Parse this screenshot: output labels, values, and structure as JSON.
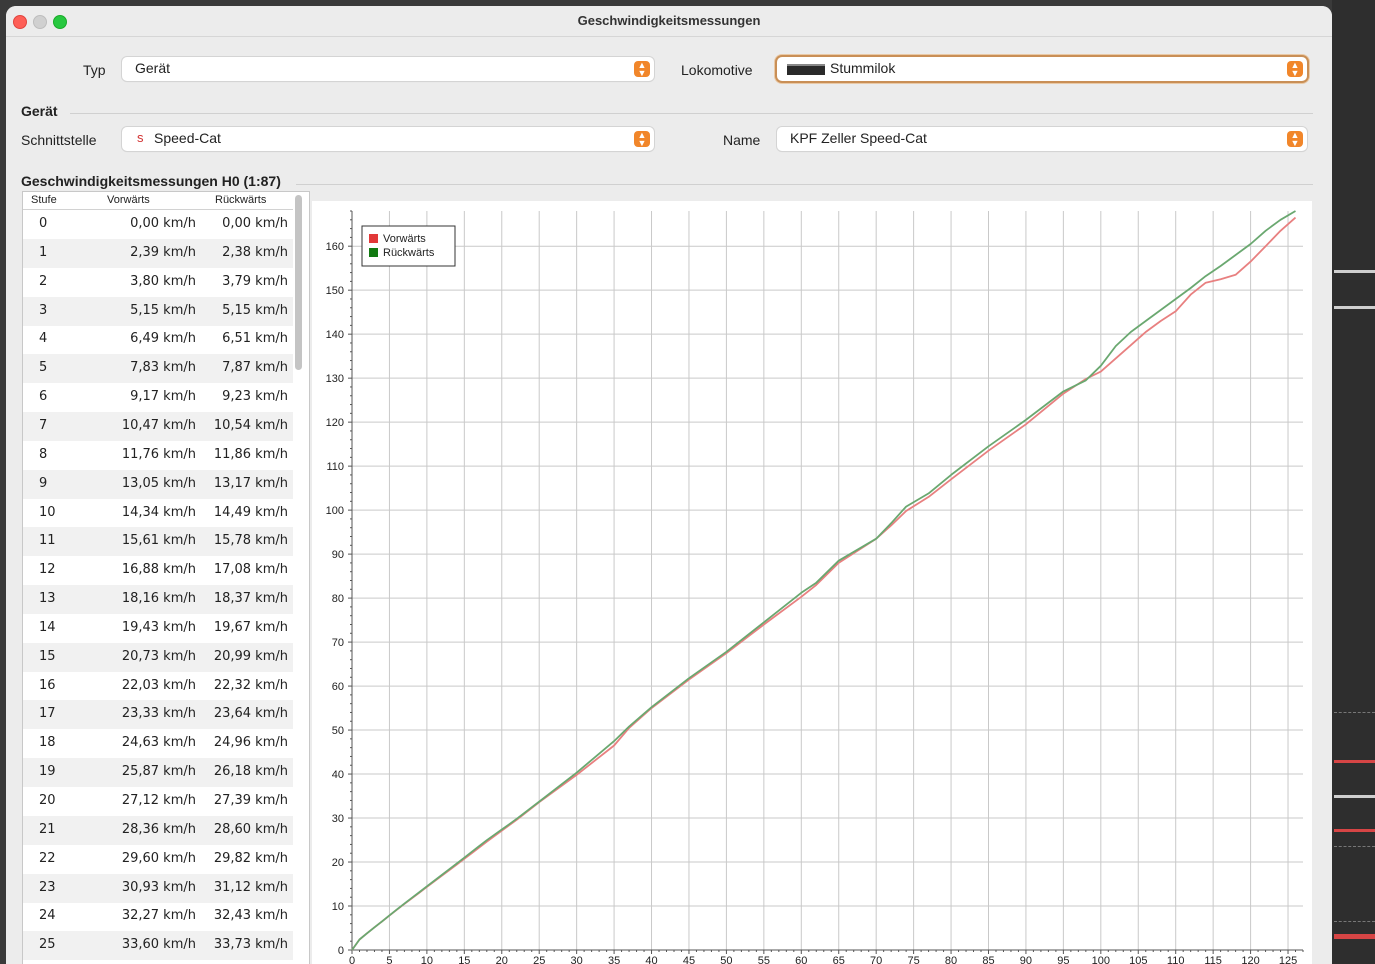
{
  "window": {
    "title": "Geschwindigkeitsmessungen"
  },
  "form": {
    "typ_label": "Typ",
    "typ_value": "Gerät",
    "lok_label": "Lokomotive",
    "lok_value": "Stummilok",
    "geraet_section": "Gerät",
    "schnittstelle_label": "Schnittstelle",
    "schnittstelle_icon": "s",
    "schnittstelle_value": "Speed-Cat",
    "name_label": "Name",
    "name_value": "KPF Zeller Speed-Cat"
  },
  "measurements": {
    "title": "Geschwindigkeitsmessungen H0 (1:87)",
    "columns": [
      "Stufe",
      "Vorwärts",
      "Rückwärts"
    ],
    "rows": [
      [
        "0",
        "0,00 km/h",
        "0,00 km/h"
      ],
      [
        "1",
        "2,39 km/h",
        "2,38 km/h"
      ],
      [
        "2",
        "3,80 km/h",
        "3,79 km/h"
      ],
      [
        "3",
        "5,15 km/h",
        "5,15 km/h"
      ],
      [
        "4",
        "6,49 km/h",
        "6,51 km/h"
      ],
      [
        "5",
        "7,83 km/h",
        "7,87 km/h"
      ],
      [
        "6",
        "9,17 km/h",
        "9,23 km/h"
      ],
      [
        "7",
        "10,47 km/h",
        "10,54 km/h"
      ],
      [
        "8",
        "11,76 km/h",
        "11,86 km/h"
      ],
      [
        "9",
        "13,05 km/h",
        "13,17 km/h"
      ],
      [
        "10",
        "14,34 km/h",
        "14,49 km/h"
      ],
      [
        "11",
        "15,61 km/h",
        "15,78 km/h"
      ],
      [
        "12",
        "16,88 km/h",
        "17,08 km/h"
      ],
      [
        "13",
        "18,16 km/h",
        "18,37 km/h"
      ],
      [
        "14",
        "19,43 km/h",
        "19,67 km/h"
      ],
      [
        "15",
        "20,73 km/h",
        "20,99 km/h"
      ],
      [
        "16",
        "22,03 km/h",
        "22,32 km/h"
      ],
      [
        "17",
        "23,33 km/h",
        "23,64 km/h"
      ],
      [
        "18",
        "24,63 km/h",
        "24,96 km/h"
      ],
      [
        "19",
        "25,87 km/h",
        "26,18 km/h"
      ],
      [
        "20",
        "27,12 km/h",
        "27,39 km/h"
      ],
      [
        "21",
        "28,36 km/h",
        "28,60 km/h"
      ],
      [
        "22",
        "29,60 km/h",
        "29,82 km/h"
      ],
      [
        "23",
        "30,93 km/h",
        "31,12 km/h"
      ],
      [
        "24",
        "32,27 km/h",
        "32,43 km/h"
      ],
      [
        "25",
        "33,60 km/h",
        "33,73 km/h"
      ]
    ]
  },
  "chart_data": {
    "type": "line",
    "title": "",
    "xlabel": "",
    "ylabel": "",
    "xlim": [
      0,
      127
    ],
    "ylim": [
      0,
      168
    ],
    "xticks": [
      0,
      5,
      10,
      15,
      20,
      25,
      30,
      35,
      40,
      45,
      50,
      55,
      60,
      65,
      70,
      75,
      80,
      85,
      90,
      95,
      100,
      105,
      110,
      115,
      120,
      125
    ],
    "yticks": [
      0,
      10,
      20,
      30,
      40,
      50,
      60,
      70,
      80,
      90,
      100,
      110,
      120,
      130,
      140,
      150,
      160
    ],
    "grid": true,
    "legend": "top-left",
    "series": [
      {
        "name": "Vorwärts",
        "color": "#e23838",
        "line_color": "#e88080",
        "x": [
          0,
          1,
          2,
          3,
          4,
          5,
          6,
          7,
          8,
          9,
          10,
          11,
          12,
          13,
          14,
          15,
          16,
          17,
          18,
          19,
          20,
          21,
          22,
          23,
          24,
          25,
          30,
          35,
          37,
          40,
          45,
          50,
          55,
          60,
          62,
          65,
          70,
          72,
          74,
          77,
          80,
          85,
          90,
          95,
          98,
          100,
          104,
          106,
          108,
          110,
          112,
          114,
          116,
          118,
          120,
          122,
          124,
          126
        ],
        "y": [
          0,
          2.39,
          3.8,
          5.15,
          6.49,
          7.83,
          9.17,
          10.47,
          11.76,
          13.05,
          14.34,
          15.61,
          16.88,
          18.16,
          19.43,
          20.73,
          22.03,
          23.33,
          24.63,
          25.87,
          27.12,
          28.36,
          29.6,
          30.93,
          32.27,
          33.6,
          39.8,
          46.5,
          50.5,
          55.0,
          61.5,
          67.5,
          74.0,
          80.3,
          83.0,
          88.0,
          93.5,
          96.5,
          99.8,
          103.0,
          107.0,
          113.5,
          119.5,
          126.5,
          129.8,
          131.5,
          137.5,
          140.5,
          143.0,
          145.2,
          149.0,
          151.7,
          152.5,
          153.5,
          156.5,
          160.0,
          163.5,
          166.5
        ]
      },
      {
        "name": "Rückwärts",
        "color": "#117a11",
        "line_color": "#6aa870",
        "x": [
          0,
          1,
          2,
          3,
          4,
          5,
          6,
          7,
          8,
          9,
          10,
          11,
          12,
          13,
          14,
          15,
          16,
          17,
          18,
          19,
          20,
          21,
          22,
          23,
          24,
          25,
          30,
          35,
          37,
          40,
          45,
          50,
          55,
          60,
          62,
          65,
          70,
          72,
          74,
          77,
          80,
          85,
          90,
          95,
          98,
          100,
          102,
          104,
          106,
          108,
          110,
          112,
          114,
          116,
          118,
          120,
          122,
          124,
          126
        ],
        "y": [
          0,
          2.38,
          3.79,
          5.15,
          6.51,
          7.87,
          9.23,
          10.54,
          11.86,
          13.17,
          14.49,
          15.78,
          17.08,
          18.37,
          19.67,
          20.99,
          22.32,
          23.64,
          24.96,
          26.18,
          27.39,
          28.6,
          29.82,
          31.12,
          32.43,
          33.73,
          40.3,
          47.5,
          50.8,
          55.2,
          61.8,
          67.8,
          74.5,
          81.2,
          83.5,
          88.5,
          93.5,
          97.0,
          100.8,
          103.8,
          108.0,
          114.5,
          120.5,
          127.0,
          129.5,
          132.8,
          137.3,
          140.5,
          143.0,
          145.5,
          148.0,
          150.5,
          153.2,
          155.5,
          158.0,
          160.5,
          163.5,
          166.0,
          168.0
        ]
      }
    ]
  }
}
